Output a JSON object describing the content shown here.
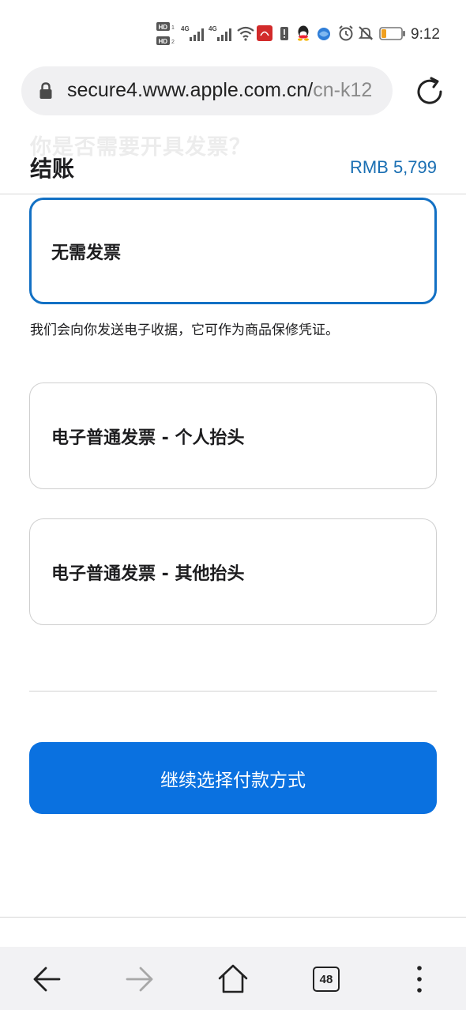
{
  "status_bar": {
    "time": "9:12",
    "network_labels": [
      "HD",
      "HD",
      "4G",
      "4G"
    ],
    "icons": [
      "signal-icon",
      "wifi-icon",
      "app-notification-icon",
      "battery-alert-icon",
      "qq-icon",
      "browser-icon",
      "alarm-icon",
      "mute-icon",
      "battery-icon"
    ],
    "battery_level": 0.25
  },
  "browser": {
    "url_main": "secure4.www.apple.com.cn/",
    "url_dim": "cn-k12",
    "tab_count": "48"
  },
  "page": {
    "ghost_heading": "你是否需要开具发票？",
    "title": "结账",
    "total": "RMB 5,799",
    "options": [
      {
        "label": "无需发票",
        "selected": true
      },
      {
        "label": "电子普通发票 - 个人抬头",
        "selected": false
      },
      {
        "label": "电子普通发票 - 其他抬头",
        "selected": false
      }
    ],
    "note": "我们会向你发送电子收据，它可作为商品保修凭证。",
    "continue_label": "继续选择付款方式"
  },
  "colors": {
    "accent": "#0a71e0",
    "selected_border": "#1270c4",
    "price": "#1a6fb3"
  }
}
